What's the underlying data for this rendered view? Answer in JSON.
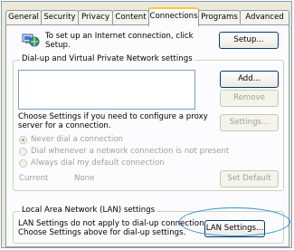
{
  "tabs": [
    {
      "label": "General"
    },
    {
      "label": "Security"
    },
    {
      "label": "Privacy"
    },
    {
      "label": "Content"
    },
    {
      "label": "Connections"
    },
    {
      "label": "Programs"
    },
    {
      "label": "Advanced"
    }
  ],
  "active_tab": "Connections",
  "setup": {
    "text_line1": "To set up an Internet connection, click",
    "text_line2": "Setup.",
    "button": "Setup..."
  },
  "dialup": {
    "title": "Dial-up and Virtual Private Network settings",
    "add": "Add...",
    "remove": "Remove",
    "settings_text_line1": "Choose Settings if you need to configure a proxy",
    "settings_text_line2": "server for a connection.",
    "settings": "Settings...",
    "radio_never": "Never dial a connection",
    "radio_whenever": "Dial whenever a network connection is not present",
    "radio_always": "Always dial my default connection",
    "current_label": "Current",
    "current_value": "None",
    "set_default": "Set Default"
  },
  "lan": {
    "title": "Local Area Network (LAN) settings",
    "text_line1": "LAN Settings do not apply to dial-up connections.",
    "text_line2": "Choose Settings above for dial-up settings.",
    "button": "LAN Settings..."
  }
}
